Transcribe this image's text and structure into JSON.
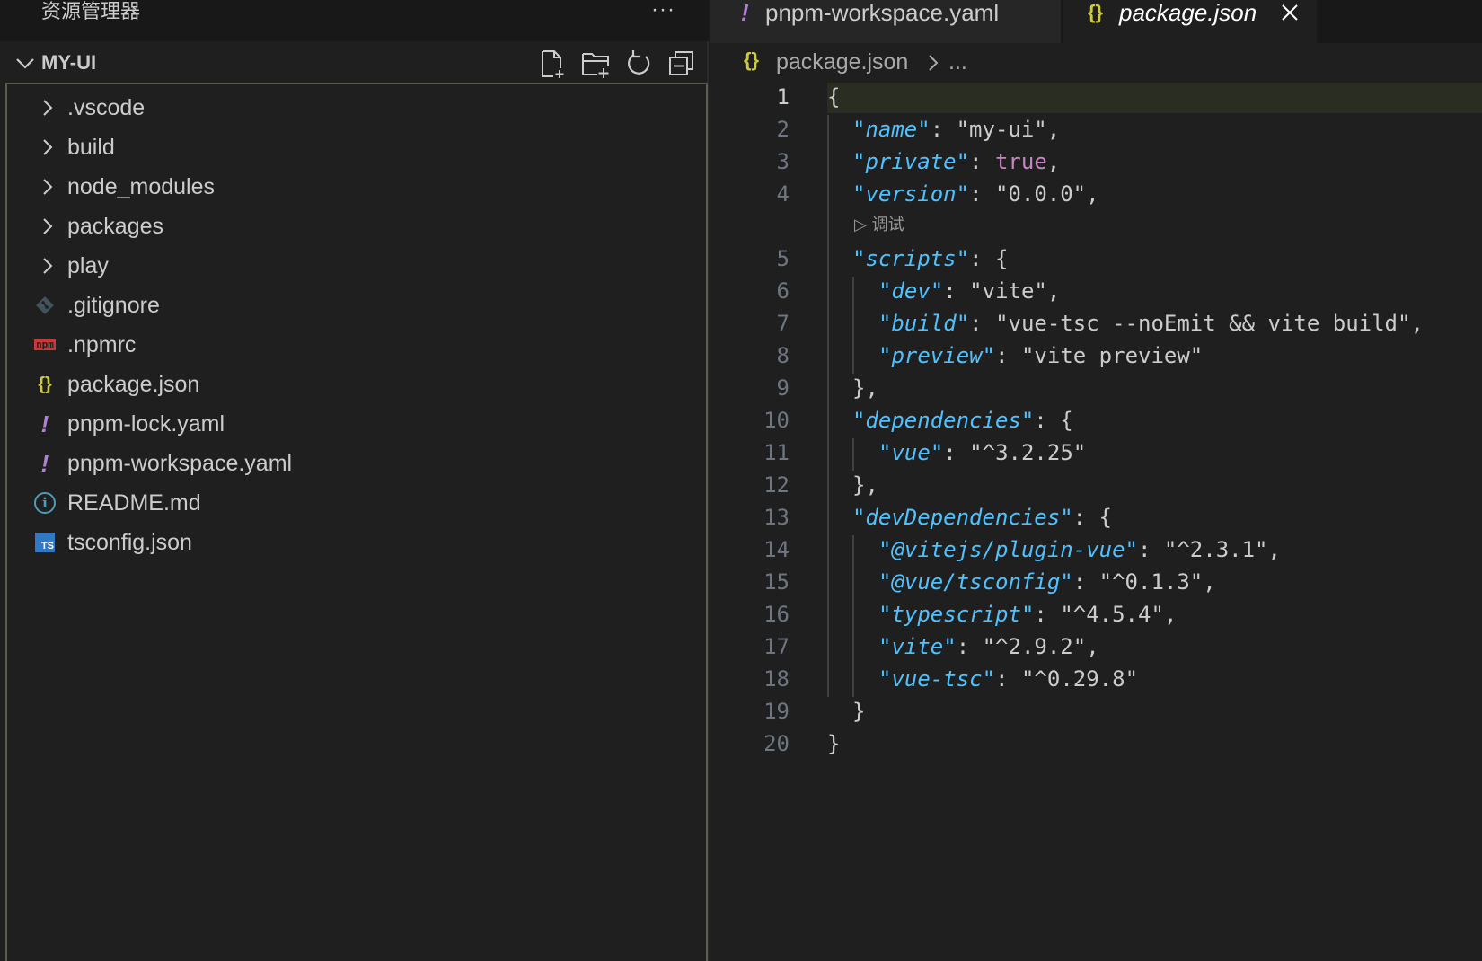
{
  "sidebar": {
    "title": "资源管理器",
    "more": "···",
    "project": "MY-UI",
    "items": [
      {
        "label": ".vscode",
        "kind": "folder",
        "icon": "chevron-right-icon"
      },
      {
        "label": "build",
        "kind": "folder",
        "icon": "chevron-right-icon"
      },
      {
        "label": "node_modules",
        "kind": "folder",
        "icon": "chevron-right-icon"
      },
      {
        "label": "packages",
        "kind": "folder",
        "icon": "chevron-right-icon"
      },
      {
        "label": "play",
        "kind": "folder",
        "icon": "chevron-right-icon"
      },
      {
        "label": ".gitignore",
        "kind": "file",
        "icon": "git-icon"
      },
      {
        "label": ".npmrc",
        "kind": "file",
        "icon": "npm-icon",
        "icon_text": "npm"
      },
      {
        "label": "package.json",
        "kind": "file",
        "icon": "json-icon",
        "icon_text": "{}"
      },
      {
        "label": "pnpm-lock.yaml",
        "kind": "file",
        "icon": "yaml-icon",
        "icon_text": "!"
      },
      {
        "label": "pnpm-workspace.yaml",
        "kind": "file",
        "icon": "yaml-icon",
        "icon_text": "!"
      },
      {
        "label": "README.md",
        "kind": "file",
        "icon": "info-icon",
        "icon_text": "i"
      },
      {
        "label": "tsconfig.json",
        "kind": "file",
        "icon": "typescript-icon",
        "icon_text": "TS"
      }
    ]
  },
  "tabs": [
    {
      "label": "pnpm-workspace.yaml",
      "icon_text": "!",
      "active": false
    },
    {
      "label": "package.json",
      "icon_text": "{}",
      "active": true
    }
  ],
  "breadcrumb": {
    "icon_text": "{}",
    "file": "package.json",
    "more": "..."
  },
  "editor": {
    "codelens": "▷ 调试",
    "lines": [
      {
        "n": "1"
      },
      {
        "n": "2"
      },
      {
        "n": "3"
      },
      {
        "n": "4"
      },
      {
        "n": "5"
      },
      {
        "n": "6"
      },
      {
        "n": "7"
      },
      {
        "n": "8"
      },
      {
        "n": "9"
      },
      {
        "n": "10"
      },
      {
        "n": "11"
      },
      {
        "n": "12"
      },
      {
        "n": "13"
      },
      {
        "n": "14"
      },
      {
        "n": "15"
      },
      {
        "n": "16"
      },
      {
        "n": "17"
      },
      {
        "n": "18"
      },
      {
        "n": "19"
      },
      {
        "n": "20"
      }
    ],
    "code": {
      "name_key": "name",
      "name_val": "\"my-ui\"",
      "private_key": "private",
      "private_val": "true",
      "version_key": "version",
      "version_val": "\"0.0.0\"",
      "scripts_key": "scripts",
      "dev_key": "dev",
      "dev_val": "\"vite\"",
      "build_key": "build",
      "build_val": "\"vue-tsc --noEmit && vite build\"",
      "preview_key": "preview",
      "preview_val": "\"vite preview\"",
      "deps_key": "dependencies",
      "vue_key": "vue",
      "vue_val": "\"^3.2.25\"",
      "devdeps_key": "devDependencies",
      "plugin_key": "@vitejs/plugin-vue",
      "plugin_val": "\"^2.3.1\"",
      "tsconfig_key": "@vue/tsconfig",
      "tsconfig_val": "\"^0.1.3\"",
      "ts_key": "typescript",
      "ts_val": "\"^4.5.4\"",
      "vite_key": "vite",
      "vite_val": "\"^2.9.2\"",
      "vuetsc_key": "vue-tsc",
      "vuetsc_val": "\"^0.29.8\""
    }
  },
  "colors": {
    "background": "#1e1e1e",
    "key": "#4fc1ff",
    "boolean": "#c586c0",
    "json_icon": "#cbcb41",
    "yaml_icon": "#b180d7",
    "npm_icon": "#cb3837"
  }
}
